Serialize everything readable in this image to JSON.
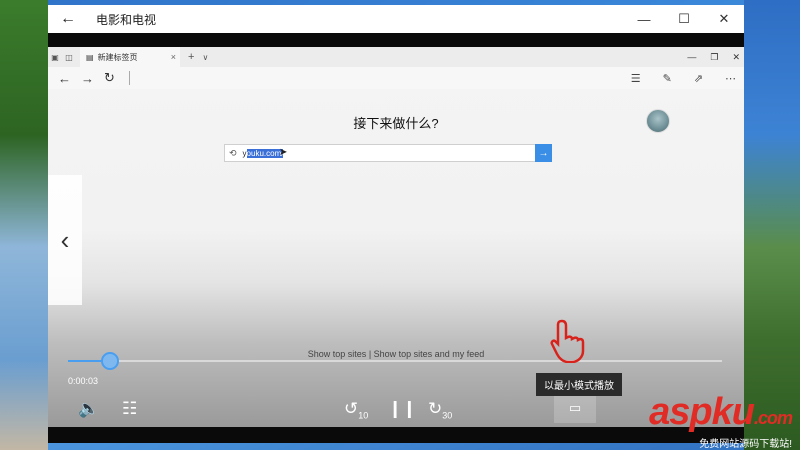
{
  "window": {
    "title": "电影和电视",
    "back_icon": "back-arrow-icon",
    "minimize_icon": "minimize-icon",
    "maximize_icon": "maximize-icon",
    "close_icon": "close-icon"
  },
  "browser": {
    "tab": {
      "label": "新建标签页"
    },
    "page_heading": "接下来做什么?",
    "search": {
      "value_plain": "y",
      "value_selected": "ouku.com/"
    },
    "top_sites": "Show top sites | Show top sites and my feed"
  },
  "player": {
    "time": "0:00:03",
    "progress_fraction": 0.064,
    "rewind_label": "10",
    "forward_label": "30",
    "tooltip": "以最小模式播放"
  },
  "watermark": {
    "brand": "aspku",
    "tld": ".com",
    "subtitle": "免费网站源码下载站!"
  }
}
